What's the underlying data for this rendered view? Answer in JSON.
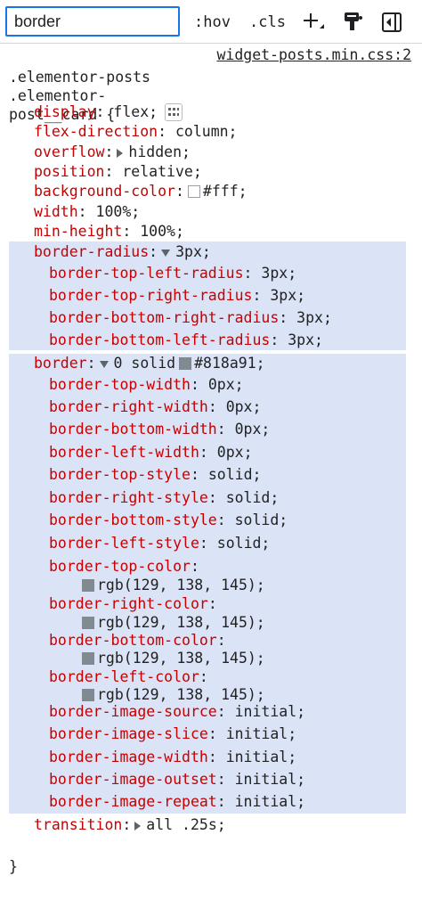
{
  "toolbar": {
    "filter_value": "border",
    "hov_label": ":hov",
    "cls_label": ".cls",
    "new_rule_icon": "plus-icon",
    "computed_icon": "paint-bucket-icon",
    "sidebar_icon": "sidebar-toggle-icon"
  },
  "rule": {
    "selector_line1": ".elementor-posts",
    "selector_line2": ".elementor-",
    "selector_line3": "post__card {",
    "source": "widget-posts.min.css:2",
    "close_brace": "}",
    "declarations": {
      "display": {
        "name": "display",
        "value": "flex;"
      },
      "flex_direction": {
        "name": "flex-direction",
        "value": "column;"
      },
      "overflow": {
        "name": "overflow",
        "value": "hidden;"
      },
      "position": {
        "name": "position",
        "value": "relative;"
      },
      "background_color": {
        "name": "background-color",
        "value": "#fff;",
        "swatch": "#ffffff"
      },
      "width": {
        "name": "width",
        "value": "100%;"
      },
      "min_height": {
        "name": "min-height",
        "value": "100%;"
      },
      "border_radius": {
        "name": "border-radius",
        "value": "3px;"
      },
      "border_top_left_radius": {
        "name": "border-top-left-radius",
        "value": "3px;"
      },
      "border_top_right_radius": {
        "name": "border-top-right-radius",
        "value": "3px;"
      },
      "border_bottom_right_radius": {
        "name": "border-bottom-right-radius",
        "value": "3px;"
      },
      "border_bottom_left_radius": {
        "name": "border-bottom-left-radius",
        "value": "3px;"
      },
      "border": {
        "name": "border",
        "value_pre": "0 solid",
        "value_post": "#818a91;",
        "swatch": "#818a91"
      },
      "border_top_width": {
        "name": "border-top-width",
        "value": "0px;"
      },
      "border_right_width": {
        "name": "border-right-width",
        "value": "0px;"
      },
      "border_bottom_width": {
        "name": "border-bottom-width",
        "value": "0px;"
      },
      "border_left_width": {
        "name": "border-left-width",
        "value": "0px;"
      },
      "border_top_style": {
        "name": "border-top-style",
        "value": "solid;"
      },
      "border_right_style": {
        "name": "border-right-style",
        "value": "solid;"
      },
      "border_bottom_style": {
        "name": "border-bottom-style",
        "value": "solid;"
      },
      "border_left_style": {
        "name": "border-left-style",
        "value": "solid;"
      },
      "border_top_color": {
        "name": "border-top-color",
        "value": "rgb(129, 138, 145);",
        "swatch": "#818a91"
      },
      "border_right_color": {
        "name": "border-right-color",
        "value": "rgb(129, 138, 145);",
        "swatch": "#818a91"
      },
      "border_bottom_color": {
        "name": "border-bottom-color",
        "value": "rgb(129, 138, 145);",
        "swatch": "#818a91"
      },
      "border_left_color": {
        "name": "border-left-color",
        "value": "rgb(129, 138, 145);",
        "swatch": "#818a91"
      },
      "border_image_source": {
        "name": "border-image-source",
        "value": "initial;"
      },
      "border_image_slice": {
        "name": "border-image-slice",
        "value": "initial;"
      },
      "border_image_width": {
        "name": "border-image-width",
        "value": "initial;"
      },
      "border_image_outset": {
        "name": "border-image-outset",
        "value": "initial;"
      },
      "border_image_repeat": {
        "name": "border-image-repeat",
        "value": "initial;"
      },
      "transition": {
        "name": "transition",
        "value": "all .25s;"
      }
    }
  },
  "colors": {
    "property_name": "#c80000",
    "highlight": "#dbe3f6",
    "focus_ring": "#1a73e8"
  }
}
